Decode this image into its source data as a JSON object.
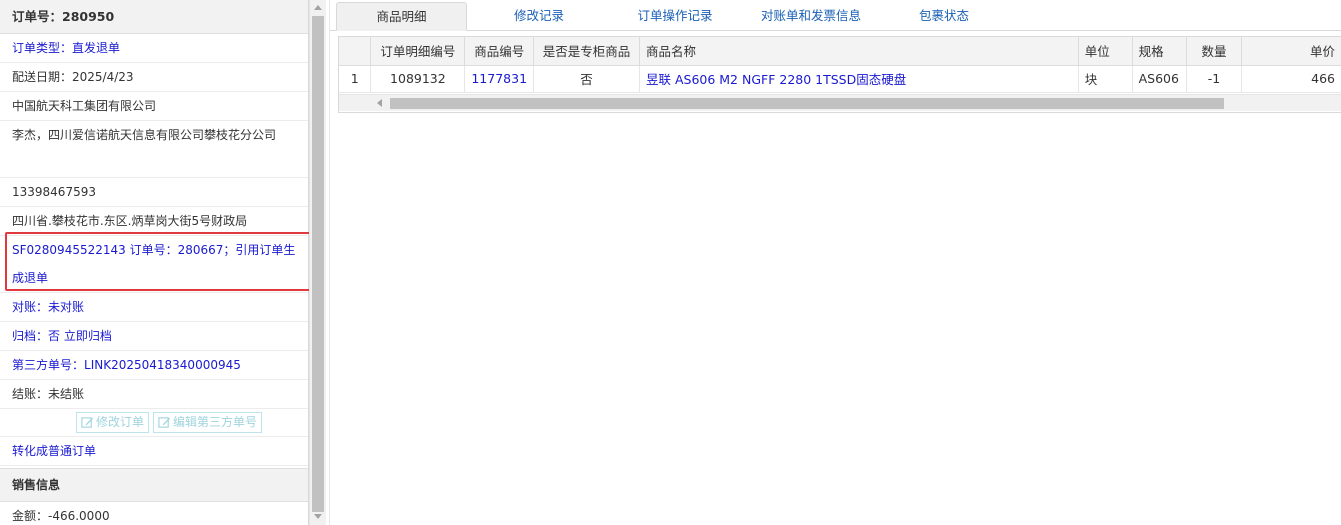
{
  "order": {
    "header": "订单号：280950",
    "type_label": "订单类型：",
    "type_value": "直发退单",
    "delivery_date": "配送日期：2025/4/23",
    "company": "中国航天科工集团有限公司",
    "contact": "李杰，四川爱信诺航天信息有限公司攀枝花分公司",
    "phone": "13398467593",
    "address": "四川省.攀枝花市.东区.炳草岗大街5号财政局",
    "note": "SF0280945522143 订单号：280667；引用订单生成退单",
    "reconcile_label": "对账：",
    "reconcile_value": "未对账",
    "archive_label": "归档：",
    "archive_value": "否 立即归档",
    "third_party_label": "第三方单号：",
    "third_party_value": "LINK20250418340000945",
    "settle": "结账：未结账",
    "edit_order_button": "修改订单",
    "edit_third_party_button": "编辑第三方单号",
    "convert_link": "转化成普通订单"
  },
  "sales": {
    "header": "销售信息",
    "amount": "金额：-466.0000"
  },
  "tabs": [
    {
      "label": "商品明细",
      "active": true
    },
    {
      "label": "修改记录",
      "active": false
    },
    {
      "label": "订单操作记录",
      "active": false
    },
    {
      "label": "对账单和发票信息",
      "active": false
    },
    {
      "label": "包裹状态",
      "active": false
    }
  ],
  "table": {
    "columns": [
      "订单明细编号",
      "商品编号",
      "是否是专柜商品",
      "商品名称",
      "单位",
      "规格",
      "数量",
      "单价"
    ],
    "rows": [
      {
        "row_number": "1",
        "detail_id": "1089132",
        "product_id": "1177831",
        "is_counter": "否",
        "name": "昱联 AS606 M2 NGFF 2280 1TSSD固态硬盘",
        "unit": "块",
        "spec": "AS606",
        "qty": "-1",
        "price": "466"
      }
    ]
  },
  "colors": {
    "link": "#1a1ad0",
    "highlight_box": "#e0393e",
    "button_disabled": "#9fd4dd"
  }
}
